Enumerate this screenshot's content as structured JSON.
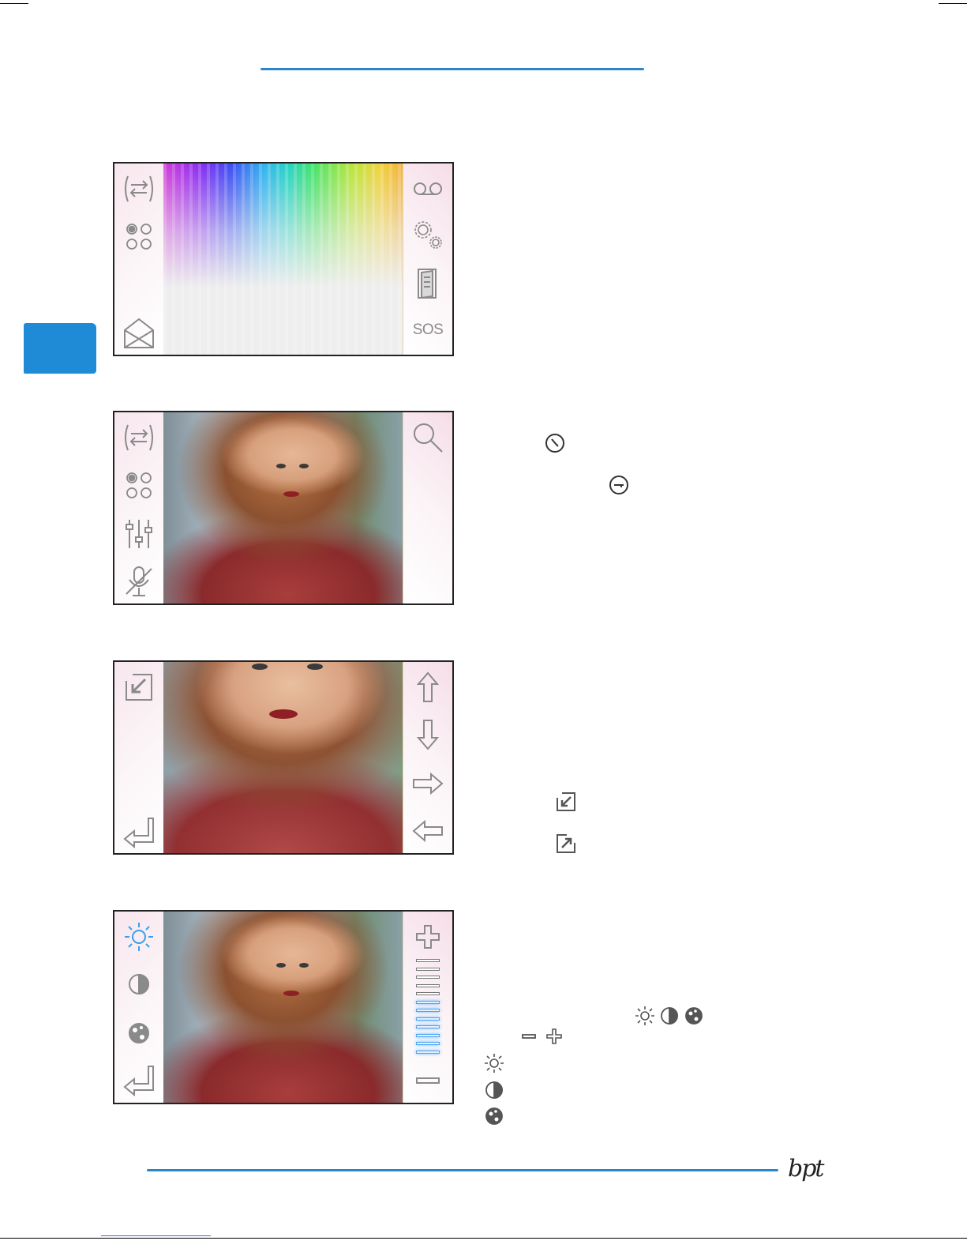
{
  "colors": {
    "accent": "#2a86c8",
    "border": "#222222",
    "icon": "#8a8a8a",
    "active": "#4aa4f0"
  },
  "screens": [
    {
      "name": "home-screen",
      "left_icons": [
        "swap-arrows-icon",
        "four-dots-icon",
        "envelope-icon"
      ],
      "right_icons": [
        "voicemail-icon",
        "settings-gears-icon",
        "door-icon",
        "sos-button"
      ],
      "sos_label": "SOS"
    },
    {
      "name": "call-screen",
      "left_icons": [
        "swap-arrows-icon",
        "four-dots-icon",
        "equalizer-icon",
        "mic-off-icon"
      ],
      "right_icons": [
        "zoom-icon"
      ]
    },
    {
      "name": "zoom-screen",
      "left_icons": [
        "zoom-out-icon",
        "back-icon"
      ],
      "right_icons": [
        "arrow-up-icon",
        "arrow-down-icon",
        "arrow-right-icon",
        "arrow-left-icon"
      ]
    },
    {
      "name": "adjust-screen",
      "left_icons": [
        "brightness-icon",
        "contrast-icon",
        "color-icon",
        "back-icon"
      ],
      "right_icons": [
        "plus-icon",
        "level-bars",
        "minus-icon"
      ],
      "level": {
        "total": 12,
        "active": 7
      }
    }
  ],
  "logo": {
    "text": "bpt"
  }
}
